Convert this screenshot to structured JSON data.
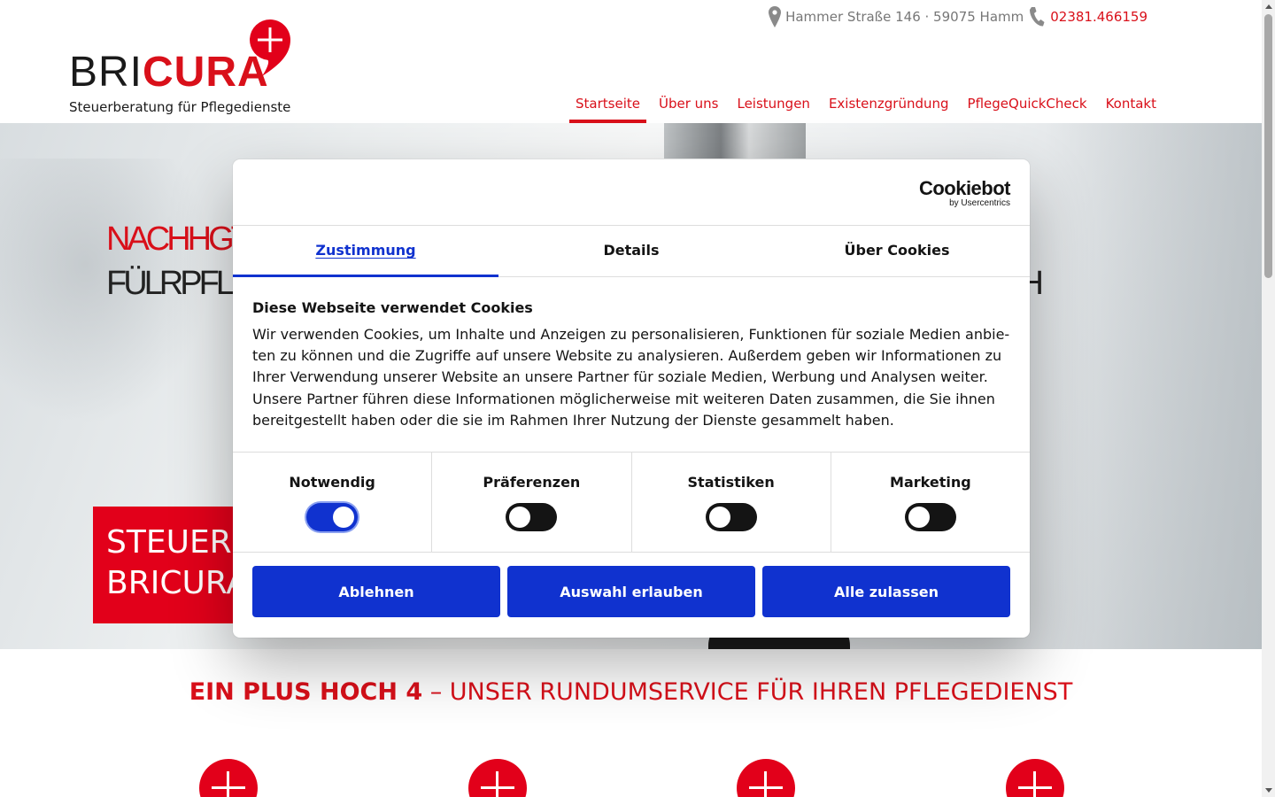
{
  "header": {
    "logo": {
      "part1": "BRI",
      "part2": "CURA",
      "tagline": "Steuerberatung für Pflegedienste"
    },
    "contact": {
      "location_icon": "map-pin-icon",
      "address": "Hammer Straße 146 · 59075 Hamm",
      "phone_icon": "phone-icon",
      "phone": "02381.466159"
    },
    "nav": [
      {
        "label": "Startseite",
        "active": true
      },
      {
        "label": "Über uns"
      },
      {
        "label": "Leistungen"
      },
      {
        "label": "Existenzgründung"
      },
      {
        "label": "PflegeQuickCheck"
      },
      {
        "label": "Kontakt"
      }
    ]
  },
  "hero": {
    "line1": "NACHHGTEN",
    "line2_left": "FÜLRPFLEC",
    "line2_right": "H",
    "box_line1": "STEUERN",
    "box_line2": "BRICURA"
  },
  "section": {
    "title_bold": "EIN PLUS HOCH 4",
    "title_rest": " – UNSER RUNDUMSERVICE FÜR IHREN PFLEGEDIENST"
  },
  "cookie": {
    "brand": "Cookiebot",
    "brand_sub": "by Usercentrics",
    "tabs": [
      "Zustimmung",
      "Details",
      "Über Cookies"
    ],
    "title": "Diese Webseite verwendet Cookies",
    "text": "Wir verwenden Cookies, um Inhalte und Anzeigen zu personalisieren, Funktionen für soziale Medien anbie-ten zu können und die Zugriffe auf unsere Website zu analysieren. Außerdem geben wir Informationen zu Ihrer Verwendung unserer Website an unsere Partner für soziale Medien, Werbung und Analysen weiter. Unsere Partner führen diese Informationen möglicherweise mit weiteren Daten zusammen, die Sie ihnen bereitgestellt haben oder die sie im Rahmen Ihrer Nutzung der Dienste gesammelt haben.",
    "toggles": [
      {
        "label": "Notwendig",
        "on": true
      },
      {
        "label": "Präferenzen",
        "on": false
      },
      {
        "label": "Statistiken",
        "on": false
      },
      {
        "label": "Marketing",
        "on": false
      }
    ],
    "buttons": {
      "decline": "Ablehnen",
      "allow_selection": "Auswahl erlauben",
      "allow_all": "Alle zulassen"
    },
    "colors": {
      "accent": "#1032cf"
    }
  },
  "colors": {
    "brand": "#d9101a"
  }
}
